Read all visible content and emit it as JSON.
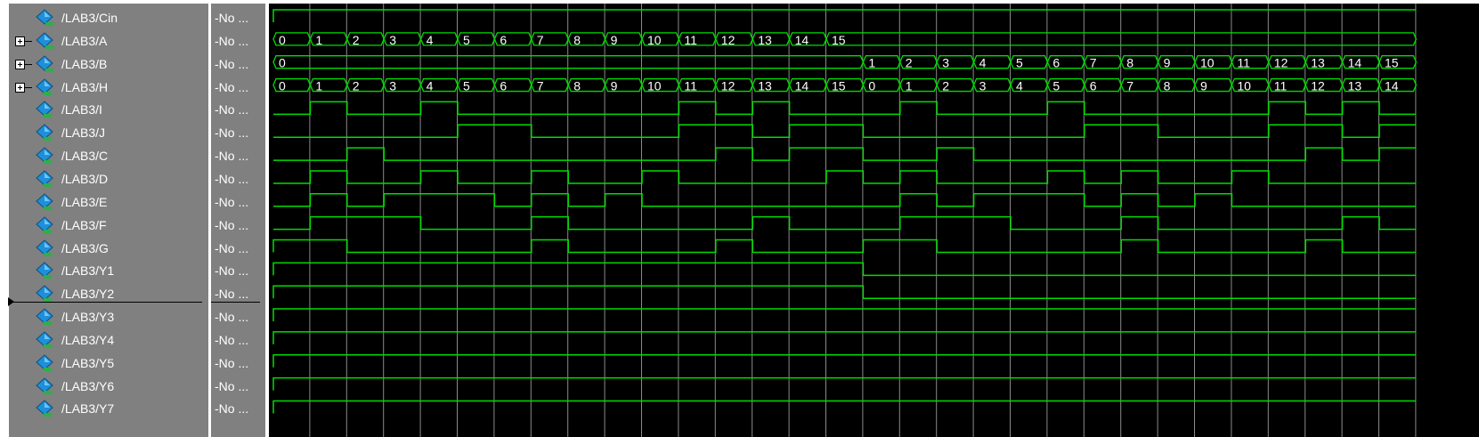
{
  "wave_window": {
    "colors": {
      "wave": "#00dd00",
      "grid": "#8a8a8a",
      "pane_bg": "#808080",
      "wave_bg": "#000000",
      "text": "#ffffff"
    },
    "time_divisions": 16,
    "signals": [
      {
        "name": "/LAB3/Cin",
        "value": "-No ...",
        "expandable": false,
        "icon": "input-signal-icon",
        "kind": "bit",
        "levels": [
          1
        ]
      },
      {
        "name": "/LAB3/A",
        "value": "-No ...",
        "expandable": true,
        "icon": "input-signal-icon",
        "kind": "bus",
        "segments": [
          {
            "label": "0",
            "start": 0,
            "end": 1
          },
          {
            "label": "1",
            "start": 1,
            "end": 2
          },
          {
            "label": "2",
            "start": 2,
            "end": 3
          },
          {
            "label": "3",
            "start": 3,
            "end": 4
          },
          {
            "label": "4",
            "start": 4,
            "end": 5
          },
          {
            "label": "5",
            "start": 5,
            "end": 6
          },
          {
            "label": "6",
            "start": 6,
            "end": 7
          },
          {
            "label": "7",
            "start": 7,
            "end": 8
          },
          {
            "label": "8",
            "start": 8,
            "end": 9
          },
          {
            "label": "9",
            "start": 9,
            "end": 10
          },
          {
            "label": "10",
            "start": 10,
            "end": 11
          },
          {
            "label": "11",
            "start": 11,
            "end": 12
          },
          {
            "label": "12",
            "start": 12,
            "end": 13
          },
          {
            "label": "13",
            "start": 13,
            "end": 14
          },
          {
            "label": "14",
            "start": 14,
            "end": 15
          },
          {
            "label": "15",
            "start": 15,
            "end": 31
          }
        ]
      },
      {
        "name": "/LAB3/B",
        "value": "-No ...",
        "expandable": true,
        "icon": "input-signal-icon",
        "kind": "bus",
        "segments": [
          {
            "label": "0",
            "start": 0,
            "end": 16
          },
          {
            "label": "1",
            "start": 16,
            "end": 17
          },
          {
            "label": "2",
            "start": 17,
            "end": 18
          },
          {
            "label": "3",
            "start": 18,
            "end": 19
          },
          {
            "label": "4",
            "start": 19,
            "end": 20
          },
          {
            "label": "5",
            "start": 20,
            "end": 21
          },
          {
            "label": "6",
            "start": 21,
            "end": 22
          },
          {
            "label": "7",
            "start": 22,
            "end": 23
          },
          {
            "label": "8",
            "start": 23,
            "end": 24
          },
          {
            "label": "9",
            "start": 24,
            "end": 25
          },
          {
            "label": "10",
            "start": 25,
            "end": 26
          },
          {
            "label": "11",
            "start": 26,
            "end": 27
          },
          {
            "label": "12",
            "start": 27,
            "end": 28
          },
          {
            "label": "13",
            "start": 28,
            "end": 29
          },
          {
            "label": "14",
            "start": 29,
            "end": 30
          },
          {
            "label": "15",
            "start": 30,
            "end": 31
          }
        ]
      },
      {
        "name": "/LAB3/H",
        "value": "-No ...",
        "expandable": true,
        "icon": "output-signal-icon",
        "kind": "bus",
        "segments": [
          {
            "label": "0",
            "start": 0,
            "end": 1
          },
          {
            "label": "1",
            "start": 1,
            "end": 2
          },
          {
            "label": "2",
            "start": 2,
            "end": 3
          },
          {
            "label": "3",
            "start": 3,
            "end": 4
          },
          {
            "label": "4",
            "start": 4,
            "end": 5
          },
          {
            "label": "5",
            "start": 5,
            "end": 6
          },
          {
            "label": "6",
            "start": 6,
            "end": 7
          },
          {
            "label": "7",
            "start": 7,
            "end": 8
          },
          {
            "label": "8",
            "start": 8,
            "end": 9
          },
          {
            "label": "9",
            "start": 9,
            "end": 10
          },
          {
            "label": "10",
            "start": 10,
            "end": 11
          },
          {
            "label": "11",
            "start": 11,
            "end": 12
          },
          {
            "label": "12",
            "start": 12,
            "end": 13
          },
          {
            "label": "13",
            "start": 13,
            "end": 14
          },
          {
            "label": "14",
            "start": 14,
            "end": 15
          },
          {
            "label": "15",
            "start": 15,
            "end": 16
          },
          {
            "label": "0",
            "start": 16,
            "end": 17
          },
          {
            "label": "1",
            "start": 17,
            "end": 18
          },
          {
            "label": "2",
            "start": 18,
            "end": 19
          },
          {
            "label": "3",
            "start": 19,
            "end": 20
          },
          {
            "label": "4",
            "start": 20,
            "end": 21
          },
          {
            "label": "5",
            "start": 21,
            "end": 22
          },
          {
            "label": "6",
            "start": 22,
            "end": 23
          },
          {
            "label": "7",
            "start": 23,
            "end": 24
          },
          {
            "label": "8",
            "start": 24,
            "end": 25
          },
          {
            "label": "9",
            "start": 25,
            "end": 26
          },
          {
            "label": "10",
            "start": 26,
            "end": 27
          },
          {
            "label": "11",
            "start": 27,
            "end": 28
          },
          {
            "label": "12",
            "start": 28,
            "end": 29
          },
          {
            "label": "13",
            "start": 29,
            "end": 30
          },
          {
            "label": "14",
            "start": 30,
            "end": 31
          }
        ]
      },
      {
        "name": "/LAB3/I",
        "value": "-No ...",
        "expandable": false,
        "icon": "output-signal-icon",
        "kind": "bit",
        "levels": [
          0,
          1,
          0,
          0,
          1,
          0,
          0,
          0,
          0,
          0,
          0,
          1,
          0,
          1,
          0,
          0,
          0,
          1,
          0,
          0,
          0,
          1,
          0,
          0,
          0,
          0,
          0,
          1,
          0,
          1,
          0
        ]
      },
      {
        "name": "/LAB3/J",
        "value": "-No ...",
        "expandable": false,
        "icon": "output-signal-icon",
        "kind": "bit",
        "levels": [
          0,
          0,
          0,
          0,
          0,
          1,
          1,
          0,
          0,
          0,
          0,
          1,
          1,
          0,
          1,
          1,
          0,
          0,
          0,
          0,
          0,
          0,
          1,
          1,
          0,
          0,
          0,
          1,
          1,
          0,
          1
        ]
      },
      {
        "name": "/LAB3/C",
        "value": "-No ...",
        "expandable": false,
        "icon": "output-signal-icon",
        "kind": "bit",
        "levels": [
          0,
          0,
          1,
          0,
          0,
          0,
          0,
          0,
          0,
          0,
          0,
          0,
          1,
          0,
          1,
          1,
          0,
          0,
          1,
          0,
          0,
          0,
          0,
          0,
          0,
          0,
          0,
          0,
          1,
          0,
          1
        ]
      },
      {
        "name": "/LAB3/D",
        "value": "-No ...",
        "expandable": false,
        "icon": "output-signal-icon",
        "kind": "bit",
        "levels": [
          0,
          1,
          0,
          0,
          1,
          0,
          0,
          1,
          0,
          0,
          1,
          0,
          0,
          0,
          0,
          1,
          0,
          1,
          0,
          0,
          0,
          1,
          0,
          1,
          0,
          0,
          1,
          0,
          0,
          0,
          0
        ]
      },
      {
        "name": "/LAB3/E",
        "value": "-No ...",
        "expandable": false,
        "icon": "output-signal-icon",
        "kind": "bit",
        "levels": [
          0,
          1,
          0,
          1,
          1,
          1,
          0,
          1,
          0,
          1,
          0,
          0,
          0,
          0,
          0,
          0,
          0,
          1,
          0,
          1,
          1,
          1,
          0,
          1,
          0,
          1,
          0,
          0,
          0,
          0,
          0
        ]
      },
      {
        "name": "/LAB3/F",
        "value": "-No ...",
        "expandable": false,
        "icon": "output-signal-icon",
        "kind": "bit",
        "levels": [
          0,
          1,
          1,
          1,
          0,
          0,
          0,
          1,
          0,
          0,
          0,
          0,
          0,
          1,
          0,
          0,
          0,
          1,
          1,
          1,
          0,
          0,
          0,
          1,
          0,
          0,
          0,
          0,
          0,
          1,
          0
        ]
      },
      {
        "name": "/LAB3/G",
        "value": "-No ...",
        "expandable": false,
        "icon": "output-signal-icon",
        "kind": "bit",
        "levels": [
          1,
          1,
          0,
          0,
          0,
          0,
          0,
          1,
          0,
          0,
          0,
          0,
          1,
          0,
          0,
          0,
          1,
          1,
          0,
          0,
          0,
          0,
          0,
          1,
          0,
          0,
          0,
          0,
          1,
          0,
          0
        ]
      },
      {
        "name": "/LAB3/Y1",
        "value": "-No ...",
        "expandable": false,
        "icon": "output-signal-icon",
        "kind": "bit",
        "levels": [
          1,
          1,
          1,
          1,
          1,
          1,
          1,
          1,
          1,
          1,
          1,
          1,
          1,
          1,
          1,
          1,
          0,
          0,
          0,
          0,
          0,
          0,
          0,
          0,
          0,
          0,
          0,
          0,
          0,
          0,
          0
        ]
      },
      {
        "name": "/LAB3/Y2",
        "value": "-No ...",
        "expandable": false,
        "icon": "output-signal-icon",
        "kind": "bit",
        "levels": [
          1,
          1,
          1,
          1,
          1,
          1,
          1,
          1,
          1,
          1,
          1,
          1,
          1,
          1,
          1,
          1,
          0,
          0,
          0,
          0,
          0,
          0,
          0,
          0,
          0,
          0,
          0,
          0,
          0,
          0,
          0
        ]
      },
      {
        "name": "/LAB3/Y3",
        "value": "-No ...",
        "expandable": false,
        "icon": "output-signal-icon",
        "kind": "bit",
        "levels": [
          1
        ]
      },
      {
        "name": "/LAB3/Y4",
        "value": "-No ...",
        "expandable": false,
        "icon": "output-signal-icon",
        "kind": "bit",
        "levels": [
          1
        ]
      },
      {
        "name": "/LAB3/Y5",
        "value": "-No ...",
        "expandable": false,
        "icon": "output-signal-icon",
        "kind": "bit",
        "levels": [
          1
        ]
      },
      {
        "name": "/LAB3/Y6",
        "value": "-No ...",
        "expandable": false,
        "icon": "output-signal-icon",
        "kind": "bit",
        "levels": [
          1
        ]
      },
      {
        "name": "/LAB3/Y7",
        "value": "-No ...",
        "expandable": false,
        "icon": "output-signal-icon",
        "kind": "bit",
        "levels": [
          1
        ]
      }
    ]
  }
}
